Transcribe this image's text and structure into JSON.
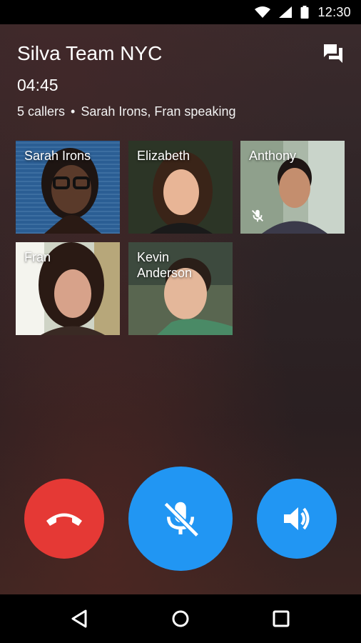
{
  "status_bar": {
    "time": "12:30",
    "icons": [
      "wifi-icon",
      "cellular-signal-icon",
      "battery-icon"
    ]
  },
  "call": {
    "title": "Silva Team NYC",
    "duration": "04:45",
    "callers_count": "5 callers",
    "separator": "•",
    "speaking": "Sarah Irons, Fran speaking"
  },
  "header_actions": {
    "chat_icon": "chat-bubbles-icon"
  },
  "participants": [
    {
      "name": "Sarah Irons",
      "muted": false
    },
    {
      "name": "Elizabeth",
      "muted": false
    },
    {
      "name": "Anthony",
      "muted": true
    },
    {
      "name": "Fran",
      "muted": false
    },
    {
      "name": "Kevin Anderson",
      "muted": false
    }
  ],
  "controls": {
    "end_call": {
      "icon": "phone-hangup-icon",
      "color": "#E53935"
    },
    "mute": {
      "icon": "mic-off-icon",
      "color": "#2196F3"
    },
    "speaker": {
      "icon": "speaker-icon",
      "color": "#2196F3"
    }
  },
  "nav_bar": {
    "icons": [
      "back-icon",
      "home-icon",
      "recents-icon"
    ]
  }
}
